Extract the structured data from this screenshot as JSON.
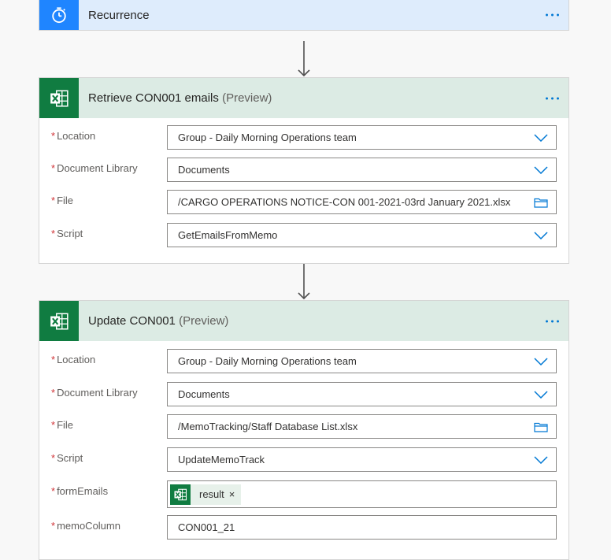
{
  "colors": {
    "accent": "#0078d4",
    "recurrence_icon_bg": "#1f85ff",
    "recurrence_header_bg": "#deecfc",
    "excel_green": "#107c41",
    "excel_header_bg": "#dcebe4",
    "required": "#d13438"
  },
  "recurrence": {
    "icon": "stopwatch-icon",
    "title": "Recurrence"
  },
  "retrieve": {
    "icon": "excel-icon",
    "title": "Retrieve CON001 emails",
    "tag": "(Preview)",
    "fields": {
      "location": {
        "label": "Location",
        "value": "Group - Daily Morning Operations team",
        "control": "chevron-down-icon"
      },
      "library": {
        "label": "Document Library",
        "value": "Documents",
        "control": "chevron-down-icon"
      },
      "file": {
        "label": "File",
        "value": "/CARGO OPERATIONS NOTICE-CON 001-2021-03rd January 2021.xlsx",
        "control": "folder-icon"
      },
      "script": {
        "label": "Script",
        "value": "GetEmailsFromMemo",
        "control": "chevron-down-icon"
      }
    }
  },
  "update": {
    "icon": "excel-icon",
    "title": "Update CON001",
    "tag": "(Preview)",
    "fields": {
      "location": {
        "label": "Location",
        "value": "Group - Daily Morning Operations team",
        "control": "chevron-down-icon"
      },
      "library": {
        "label": "Document Library",
        "value": "Documents",
        "control": "chevron-down-icon"
      },
      "file": {
        "label": "File",
        "value": "/MemoTracking/Staff Database List.xlsx",
        "control": "folder-icon"
      },
      "script": {
        "label": "Script",
        "value": "UpdateMemoTrack",
        "control": "chevron-down-icon"
      },
      "form_emails": {
        "label": "formEmails",
        "token": "result",
        "token_close": "×"
      },
      "memo_column": {
        "label": "memoColumn",
        "value": "CON001_21"
      }
    }
  },
  "required_marker": "*"
}
